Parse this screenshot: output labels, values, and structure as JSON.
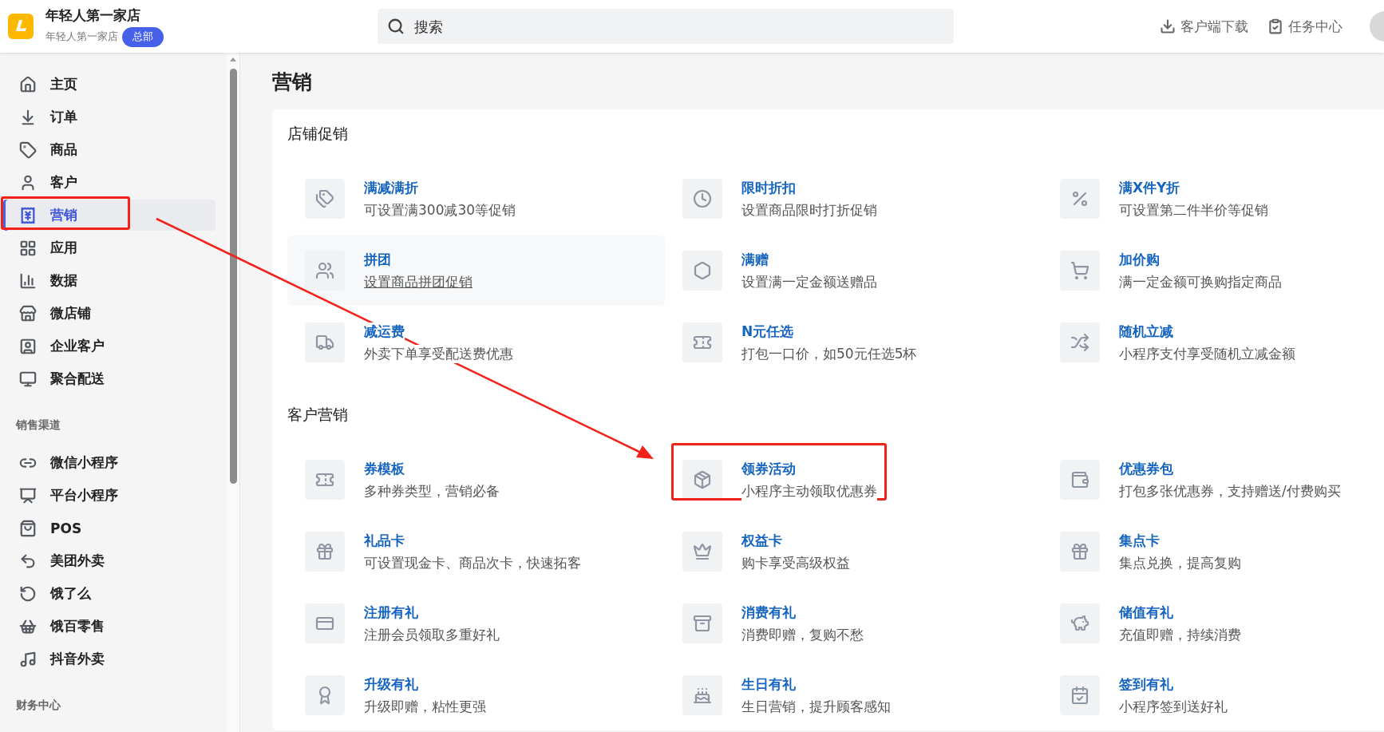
{
  "header": {
    "store_name": "年轻人第一家店",
    "store_subtitle": "年轻人第一家店",
    "badge": "总部"
  },
  "search": {
    "placeholder": "搜索"
  },
  "header_actions": [
    {
      "label": "客户端下载"
    },
    {
      "label": "任务中心"
    }
  ],
  "sidebar": {
    "items": [
      {
        "label": "主页",
        "selected": false,
        "annotated": false
      },
      {
        "label": "订单",
        "selected": false,
        "annotated": false
      },
      {
        "label": "商品",
        "selected": false,
        "annotated": false
      },
      {
        "label": "客户",
        "selected": false,
        "annotated": false
      },
      {
        "label": "营销",
        "selected": true,
        "annotated": true
      },
      {
        "label": "应用",
        "selected": false,
        "annotated": false
      },
      {
        "label": "数据",
        "selected": false,
        "annotated": false
      },
      {
        "label": "微店铺",
        "selected": false,
        "annotated": false
      },
      {
        "label": "企业客户",
        "selected": false,
        "annotated": false
      },
      {
        "label": "聚合配送",
        "selected": false,
        "annotated": false
      }
    ],
    "sections": [
      {
        "title": "销售渠道",
        "items": [
          {
            "label": "微信小程序",
            "selected": false,
            "annotated": false
          },
          {
            "label": "平台小程序",
            "selected": false,
            "annotated": false
          },
          {
            "label": "POS",
            "selected": false,
            "annotated": false
          },
          {
            "label": "美团外卖",
            "selected": false,
            "annotated": false
          },
          {
            "label": "饿了么",
            "selected": false,
            "annotated": false
          },
          {
            "label": "饿百零售",
            "selected": false,
            "annotated": false
          },
          {
            "label": "抖音外卖",
            "selected": false,
            "annotated": false
          }
        ]
      },
      {
        "title": "财务中心"
      }
    ]
  },
  "page_title": "营销",
  "sections": [
    {
      "title": "店铺促销",
      "items": [
        {
          "title": "满减满折",
          "description": "可设置满300减30等促销",
          "hovered": false,
          "annotated": false
        },
        {
          "title": "限时折扣",
          "description": "设置商品限时打折促销",
          "hovered": false,
          "annotated": false
        },
        {
          "title": "满X件Y折",
          "description": "可设置第二件半价等促销",
          "hovered": false,
          "annotated": false
        },
        {
          "title": "拼团",
          "description": "设置商品拼团促销",
          "hovered": true,
          "annotated": false
        },
        {
          "title": "满赠",
          "description": "设置满一定金额送赠品",
          "hovered": false,
          "annotated": false
        },
        {
          "title": "加价购",
          "description": "满一定金额可换购指定商品",
          "hovered": false,
          "annotated": false
        },
        {
          "title": "减运费",
          "description": "外卖下单享受配送费优惠",
          "hovered": false,
          "annotated": false
        },
        {
          "title": "N元任选",
          "description": "打包一口价，如50元任选5杯",
          "hovered": false,
          "annotated": false
        },
        {
          "title": "随机立减",
          "description": "小程序支付享受随机立减金额",
          "hovered": false,
          "annotated": false
        }
      ]
    },
    {
      "title": "客户营销",
      "items": [
        {
          "title": "券模板",
          "description": "多种券类型，营销必备",
          "hovered": false,
          "annotated": false
        },
        {
          "title": "领券活动",
          "description": "小程序主动领取优惠券",
          "hovered": false,
          "annotated": true
        },
        {
          "title": "优惠券包",
          "description": "打包多张优惠券，支持赠送/付费购买",
          "hovered": false,
          "annotated": false
        },
        {
          "title": "礼品卡",
          "description": "可设置现金卡、商品次卡，快速拓客",
          "hovered": false,
          "annotated": false
        },
        {
          "title": "权益卡",
          "description": "购卡享受高级权益",
          "hovered": false,
          "annotated": false
        },
        {
          "title": "集点卡",
          "description": "集点兑换，提高复购",
          "hovered": false,
          "annotated": false
        },
        {
          "title": "注册有礼",
          "description": "注册会员领取多重好礼",
          "hovered": false,
          "annotated": false
        },
        {
          "title": "消费有礼",
          "description": "消费即赠，复购不愁",
          "hovered": false,
          "annotated": false
        },
        {
          "title": "储值有礼",
          "description": "充值即赠，持续消费",
          "hovered": false,
          "annotated": false
        },
        {
          "title": "升级有礼",
          "description": "升级即赠，粘性更强",
          "hovered": false,
          "annotated": false
        },
        {
          "title": "生日有礼",
          "description": "生日营销，提升顾客感知",
          "hovered": false,
          "annotated": false
        },
        {
          "title": "签到有礼",
          "description": "小程序签到送好礼",
          "hovered": false,
          "annotated": false
        }
      ]
    }
  ]
}
